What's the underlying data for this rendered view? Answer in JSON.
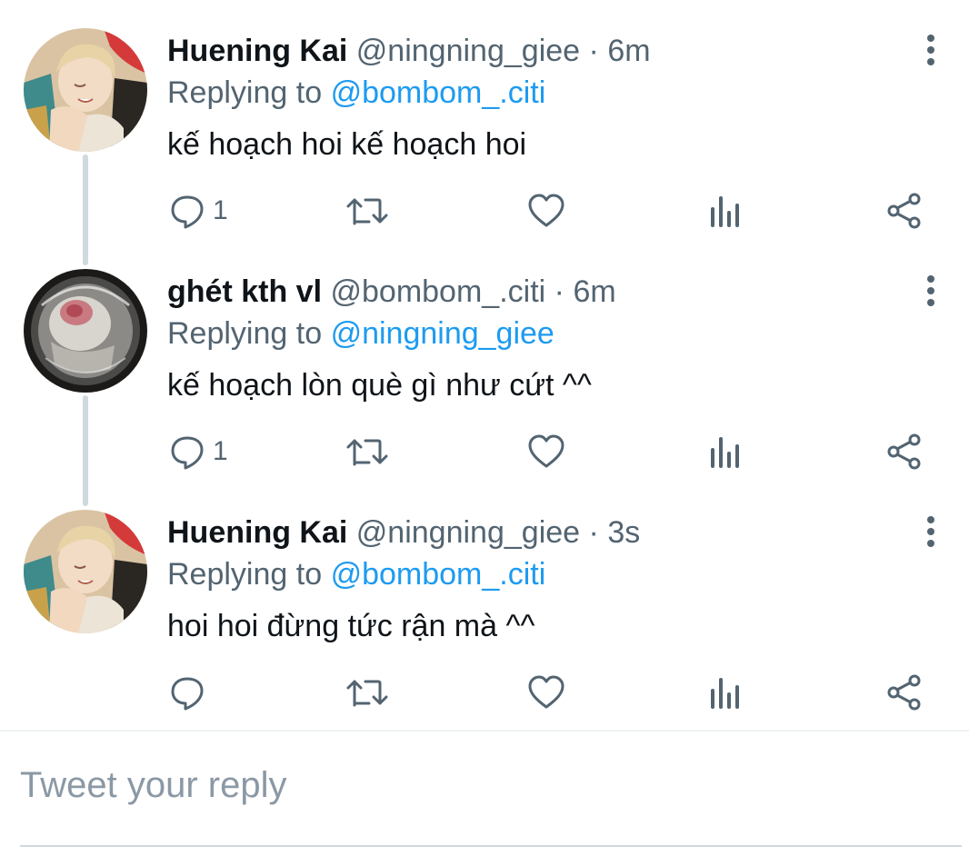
{
  "tweets": [
    {
      "name": "Huening Kai",
      "handle": "@ningning_giee",
      "separator": "·",
      "time": "6m",
      "replying_prefix": "Replying to",
      "replying_to": "@bombom_.citi",
      "text": "kế hoạch hoi kế hoạch hoi",
      "reply_count": "1",
      "avatar": "person-photo"
    },
    {
      "name": "ghét kth vl",
      "handle": "@bombom_.citi",
      "separator": "·",
      "time": "6m",
      "replying_prefix": "Replying to",
      "replying_to": "@ningning_giee",
      "text": "kế hoạch lòn què gì như cứt ^^",
      "reply_count": "1",
      "avatar": "hamster-ball-photo"
    },
    {
      "name": "Huening Kai",
      "handle": "@ningning_giee",
      "separator": "·",
      "time": "3s",
      "replying_prefix": "Replying to",
      "replying_to": "@bombom_.citi",
      "text": "hoi hoi đừng tức rận mà ^^",
      "reply_count": "",
      "avatar": "person-photo"
    }
  ],
  "reply_box": {
    "placeholder": "Tweet your reply"
  },
  "colors": {
    "accent": "#1d9bf0",
    "muted": "#536471",
    "text": "#0f1419"
  },
  "icons": [
    "reply-icon",
    "retweet-icon",
    "like-icon",
    "stats-icon",
    "share-icon",
    "more-icon"
  ]
}
